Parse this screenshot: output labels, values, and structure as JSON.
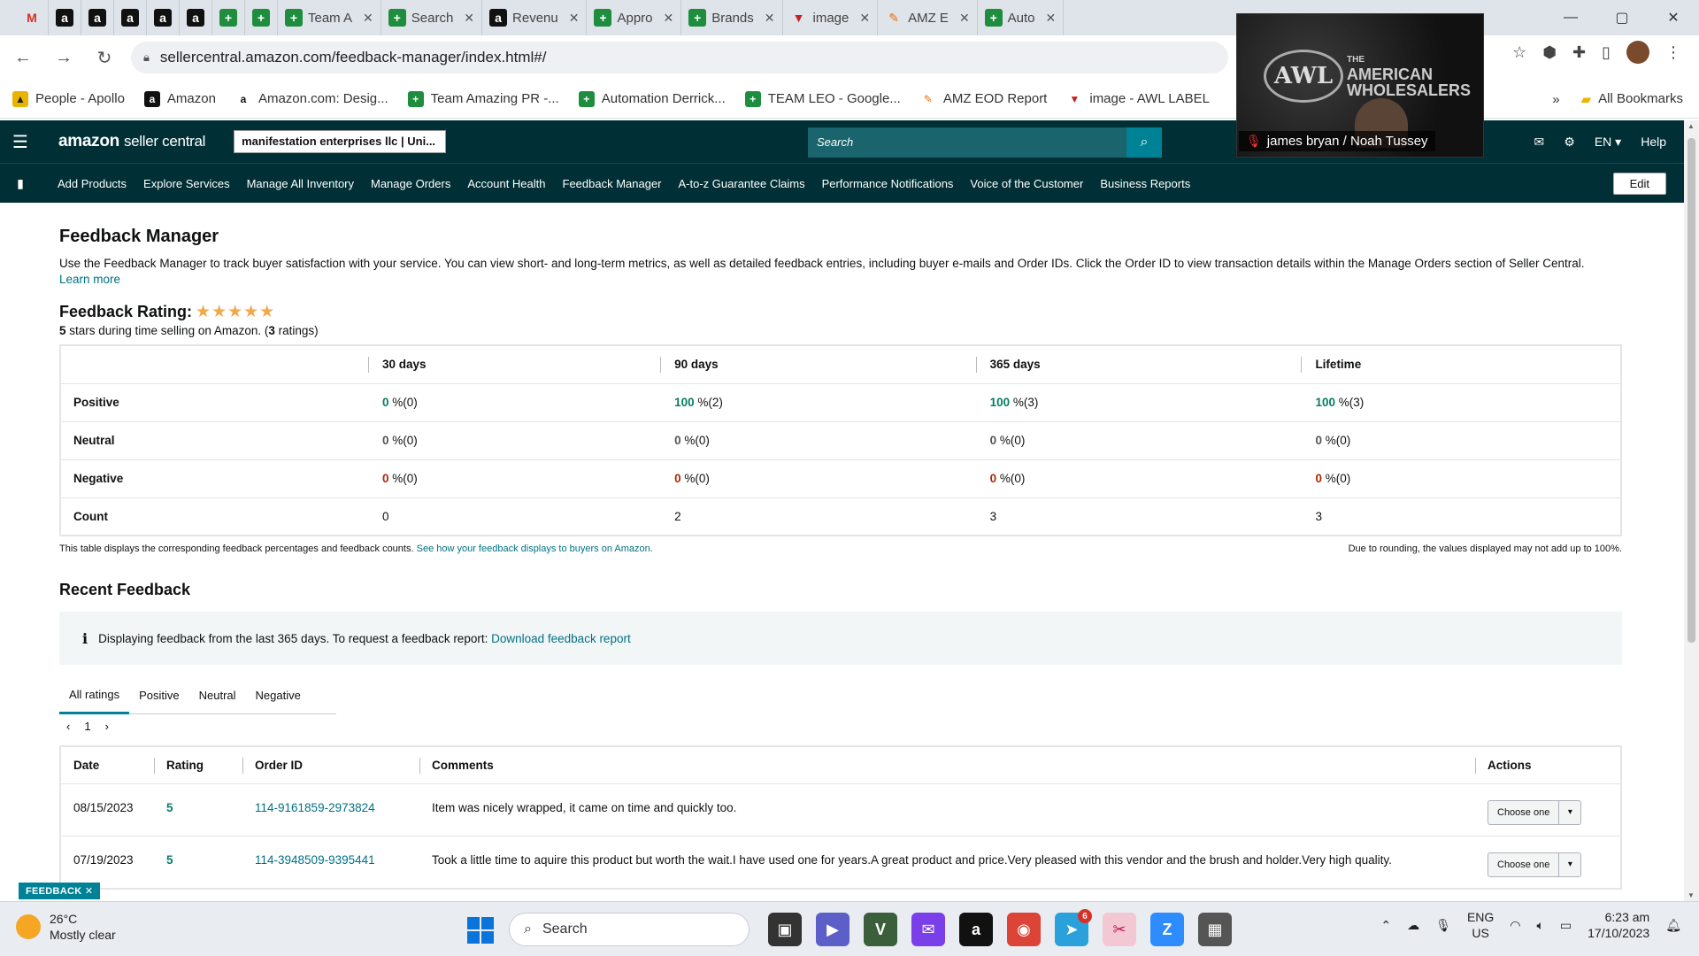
{
  "browser": {
    "tabs": [
      {
        "label": "",
        "icon": "gmail-icon"
      },
      {
        "label": "",
        "icon": "amazon-icon"
      },
      {
        "label": "",
        "icon": "amazon-icon"
      },
      {
        "label": "",
        "icon": "amazon-icon"
      },
      {
        "label": "",
        "icon": "amazon-icon"
      },
      {
        "label": "",
        "icon": "amazon-icon"
      },
      {
        "label": "",
        "icon": "sheets-icon"
      },
      {
        "label": "",
        "icon": "sheets-icon"
      },
      {
        "label": "Team A",
        "icon": "sheets-icon"
      },
      {
        "label": "Search",
        "icon": "sheets-icon"
      },
      {
        "label": "Revenu",
        "icon": "amazon-icon"
      },
      {
        "label": "Appro",
        "icon": "sheets-icon"
      },
      {
        "label": "Brands",
        "icon": "sheets-icon"
      },
      {
        "label": "image",
        "icon": "label-icon"
      },
      {
        "label": "AMZ E",
        "icon": "zapier-icon"
      },
      {
        "label": "Auto",
        "icon": "sheets-icon"
      }
    ],
    "url": "sellercentral.amazon.com/feedback-manager/index.html#/",
    "bookmarks": [
      {
        "label": "People - Apollo"
      },
      {
        "label": "Amazon"
      },
      {
        "label": "Amazon.com: Desig..."
      },
      {
        "label": "Team Amazing PR -..."
      },
      {
        "label": "Automation Derrick..."
      },
      {
        "label": "TEAM LEO - Google..."
      },
      {
        "label": "AMZ EOD Report"
      },
      {
        "label": "image - AWL LABEL"
      }
    ],
    "bookmarks_more": "»",
    "all_bookmarks": "All Bookmarks"
  },
  "seller": {
    "logo_a": "amazon",
    "logo_b": "seller central",
    "account": "manifestation enterprises llc | Uni...",
    "search_placeholder": "Search",
    "lang": "EN ▾",
    "help": "Help",
    "nav": [
      "Add Products",
      "Explore Services",
      "Manage All Inventory",
      "Manage Orders",
      "Account Health",
      "Feedback Manager",
      "A-to-z Guarantee Claims",
      "Performance Notifications",
      "Voice of the Customer",
      "Business Reports"
    ],
    "edit": "Edit"
  },
  "page": {
    "title": "Feedback Manager",
    "description": "Use the Feedback Manager to track buyer satisfaction with your service. You can view short- and long-term metrics, as well as detailed feedback entries, including buyer e-mails and Order IDs. Click the Order ID to view transaction details within the Manage Orders section of Seller Central.",
    "learn_more": "Learn more",
    "rating_label": "Feedback Rating:",
    "rating_stars": 5,
    "stars_text": "★★★★★",
    "rating_sub_a": "5",
    "rating_sub_b": " stars during time selling on Amazon. (",
    "rating_sub_c": "3",
    "rating_sub_d": " ratings)",
    "metrics": {
      "headers": [
        "30 days",
        "90 days",
        "365 days",
        "Lifetime"
      ],
      "rows": [
        {
          "label": "Positive",
          "cells": [
            {
              "v": "0",
              "s": " %(0)"
            },
            {
              "v": "100",
              "s": " %(2)"
            },
            {
              "v": "100",
              "s": " %(3)"
            },
            {
              "v": "100",
              "s": " %(3)"
            }
          ]
        },
        {
          "label": "Neutral",
          "cells": [
            {
              "v": "0",
              "s": " %(0)"
            },
            {
              "v": "0",
              "s": " %(0)"
            },
            {
              "v": "0",
              "s": " %(0)"
            },
            {
              "v": "0",
              "s": " %(0)"
            }
          ]
        },
        {
          "label": "Negative",
          "cells": [
            {
              "v": "0",
              "s": " %(0)"
            },
            {
              "v": "0",
              "s": " %(0)"
            },
            {
              "v": "0",
              "s": " %(0)"
            },
            {
              "v": "0",
              "s": " %(0)"
            }
          ]
        },
        {
          "label": "Count",
          "cells": [
            {
              "v": "0",
              "s": ""
            },
            {
              "v": "2",
              "s": ""
            },
            {
              "v": "3",
              "s": ""
            },
            {
              "v": "3",
              "s": ""
            }
          ]
        }
      ]
    },
    "footnote_left": "This table displays the corresponding feedback percentages and feedback counts.",
    "footnote_link": "See how your feedback displays to buyers on Amazon.",
    "footnote_right": "Due to rounding, the values displayed may not add up to 100%.",
    "recent_title": "Recent Feedback",
    "info_text": "Displaying feedback from the last 365 days. To request a feedback report:",
    "info_link": "Download feedback report",
    "tabs": [
      "All ratings",
      "Positive",
      "Neutral",
      "Negative"
    ],
    "page_num": "1",
    "feed_headers": [
      "Date",
      "Rating",
      "Order ID",
      "Comments",
      "Actions"
    ],
    "feed_rows": [
      {
        "date": "08/15/2023",
        "rating": "5",
        "order": "114-9161859-2973824",
        "comment": "Item was nicely wrapped, it came on time and quickly too.",
        "action": "Choose one"
      },
      {
        "date": "07/19/2023",
        "rating": "5",
        "order": "114-3948509-9395441",
        "comment": "Took a little time to aquire this product but worth the wait.I have used one for years.A great product and price.Very pleased with this vendor and the brush and holder.Very high quality.",
        "action": "Choose one"
      }
    ],
    "feedback_tab": "FEEDBACK ✕"
  },
  "video": {
    "name": "james bryan / Noah Tussey",
    "brand_top": "THE",
    "brand_main": "AMERICAN",
    "brand_bottom": "WHOLESALERS",
    "logo": "AWL"
  },
  "taskbar": {
    "temp": "26°C",
    "weather": "Mostly clear",
    "search": "Search",
    "lang_a": "ENG",
    "lang_b": "US",
    "time": "6:23 am",
    "date": "17/10/2023",
    "badge": "6"
  }
}
